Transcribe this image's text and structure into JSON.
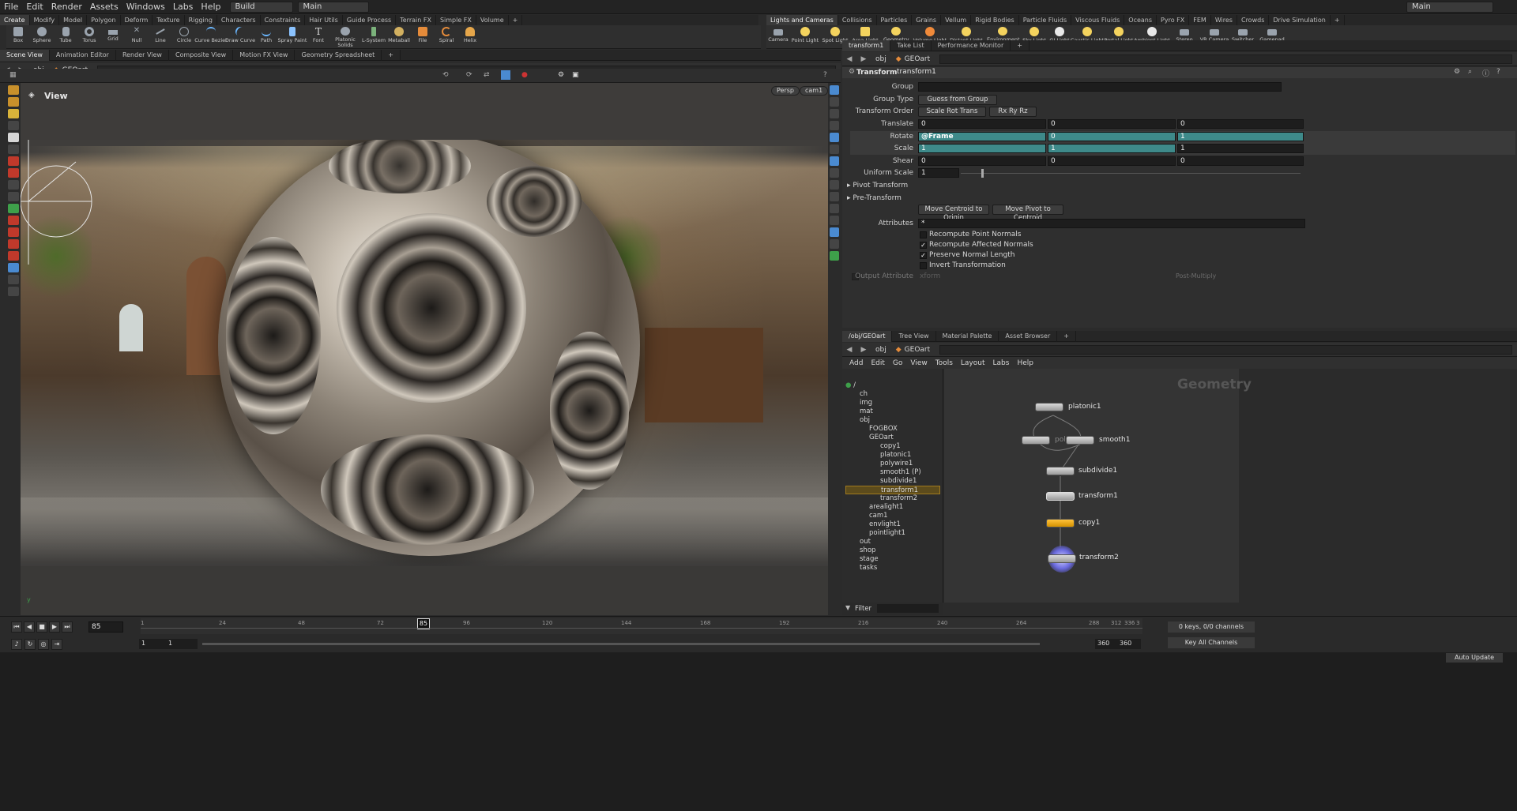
{
  "menubar": {
    "items": [
      "File",
      "Edit",
      "Render",
      "Assets",
      "Windows",
      "Labs",
      "Help"
    ],
    "desktop": "Build",
    "context": "Main",
    "right_context": "Main"
  },
  "shelf_tabs_left": [
    "Create",
    "Modify",
    "Model",
    "Polygon",
    "Deform",
    "Texture",
    "Rigging",
    "Characters",
    "Constraints",
    "Hair Utils",
    "Guide Process",
    "Terrain FX",
    "Simple FX",
    "Volume"
  ],
  "shelf_tabs_right": [
    "Lights and Cameras",
    "Collisions",
    "Particles",
    "Grains",
    "Vellum",
    "Rigid Bodies",
    "Particle Fluids",
    "Viscous Fluids",
    "Oceans",
    "Pyro FX",
    "FEM",
    "Wires",
    "Crowds",
    "Drive Simulation"
  ],
  "tools_left": [
    "Box",
    "Sphere",
    "Tube",
    "Torus",
    "Grid",
    "Null",
    "Line",
    "Circle",
    "Curve Bezier",
    "Draw Curve",
    "Path",
    "Spray Paint",
    "Font",
    "Platonic Solids",
    "L-System",
    "Metaball",
    "File",
    "Spiral",
    "Helix"
  ],
  "tools_right": [
    "Camera",
    "Point Light",
    "Spot Light",
    "Area Light",
    "Geometry Light",
    "Volume Light",
    "Distant Light",
    "Environment Light",
    "Sky Light",
    "GI Light",
    "Caustic Light",
    "Portal Light",
    "Ambient Light",
    "Stereo Camera",
    "VR Camera",
    "Switcher",
    "Gamepad Camera"
  ],
  "viewer_tabs": [
    "Scene View",
    "Animation Editor",
    "Render View",
    "Composite View",
    "Motion FX View",
    "Geometry Spreadsheet"
  ],
  "viewer_path": {
    "root": "obj",
    "node": "GEOart"
  },
  "viewport": {
    "title": "View",
    "persp": "Persp",
    "cam": "cam1"
  },
  "timeline": {
    "frame": "85",
    "start": "1",
    "start2": "1",
    "end": "360",
    "end2": "360",
    "ticks": [
      "1",
      "24",
      "48",
      "72",
      "96",
      "120",
      "144",
      "168",
      "192",
      "216",
      "240",
      "264",
      "288",
      "312",
      "336",
      "3"
    ],
    "marker": "85",
    "keys": "0 keys, 0/0 channels",
    "key_all": "Key All Channels",
    "auto_update": "Auto Update"
  },
  "param_tabs": [
    "transform1",
    "Take List",
    "Performance Monitor"
  ],
  "param_path": {
    "root": "obj",
    "node": "GEOart"
  },
  "params": {
    "node_type": "Transform",
    "node_name": "transform1",
    "group_label": "Group",
    "group_type_label": "Group Type",
    "group_type": "Guess from Group",
    "order_label": "Transform Order",
    "order": "Scale Rot Trans",
    "rot_order": "Rx Ry Rz",
    "translate_label": "Translate",
    "translate": [
      "0",
      "0",
      "0"
    ],
    "rotate_label": "Rotate",
    "rotate": [
      "@Frame",
      "0",
      "1"
    ],
    "scale_label": "Scale",
    "scale": [
      "1",
      "1",
      "1"
    ],
    "shear_label": "Shear",
    "shear": [
      "0",
      "0",
      "0"
    ],
    "uniform_label": "Uniform Scale",
    "uniform": "1",
    "pivot_label": "Pivot Transform",
    "pre_label": "Pre-Transform",
    "btn_centroid": "Move Centroid to Origin",
    "btn_pivot": "Move Pivot to Centroid",
    "attr_label": "Attributes",
    "attr": "*",
    "chk1": "Recompute Point Normals",
    "chk2": "Recompute Affected Normals",
    "chk3": "Preserve Normal Length",
    "chk4": "Invert Transformation",
    "out_label": "Output Attribute",
    "out_value": "xform",
    "post": "Post-Multiply"
  },
  "net_tabs": [
    "/obj/GEOart",
    "Tree View",
    "Material Palette",
    "Asset Browser"
  ],
  "net_path": {
    "root": "obj",
    "node": "GEOart"
  },
  "net_menu": [
    "Add",
    "Edit",
    "Go",
    "View",
    "Tools",
    "Layout",
    "Labs",
    "Help"
  ],
  "tree": [
    {
      "l": "/"
    },
    {
      "l": "ch"
    },
    {
      "l": "img"
    },
    {
      "l": "mat"
    },
    {
      "l": "obj"
    },
    {
      "l": "FOGBOX"
    },
    {
      "l": "GEOart"
    },
    {
      "l": "copy1"
    },
    {
      "l": "platonic1"
    },
    {
      "l": "polywire1"
    },
    {
      "l": "smooth1 (P)"
    },
    {
      "l": "subdivide1"
    },
    {
      "l": "transform1"
    },
    {
      "l": "transform2"
    },
    {
      "l": "arealight1"
    },
    {
      "l": "cam1"
    },
    {
      "l": "envlight1"
    },
    {
      "l": "pointlight1"
    },
    {
      "l": "out"
    },
    {
      "l": "shop"
    },
    {
      "l": "stage"
    },
    {
      "l": "tasks"
    }
  ],
  "network": {
    "label": "Geometry",
    "nodes": [
      "platonic1",
      "polywire1",
      "smooth1",
      "subdivide1",
      "transform1",
      "copy1",
      "transform2"
    ]
  },
  "filter_label": "Filter"
}
